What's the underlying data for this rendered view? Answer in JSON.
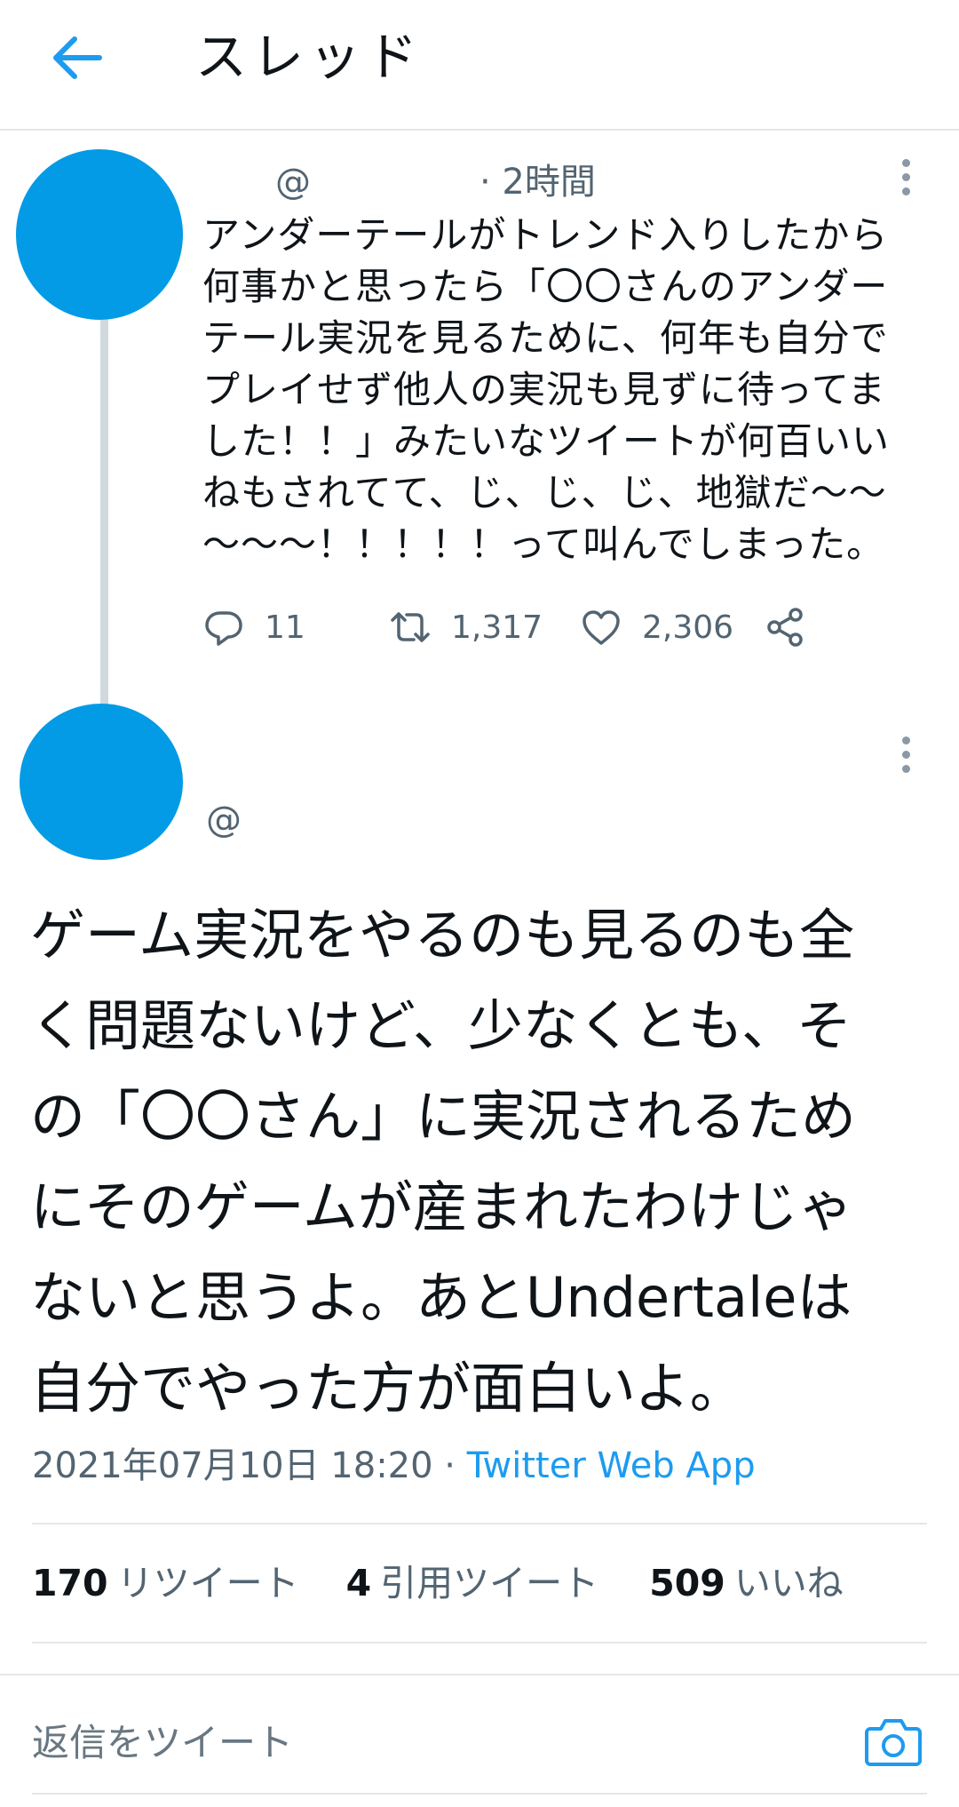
{
  "header": {
    "title": "スレッド",
    "back_icon": "arrow-left-icon",
    "accent": "#1d9bf0"
  },
  "avatar_color": "#039be5",
  "tweet1": {
    "handle": "@",
    "time": "· 2時間",
    "text": "アンダーテールがトレンド入りしたから\n何事かと思ったら「〇〇さんのアンダー\nテール実況を見るために、何年も自分で\nプレイせず他人の実況も見ずに待ってま\nした！！」みたいなツイートが何百いい\nねもされてて、じ、じ、じ、地獄だ〜〜\n〜〜〜！！！！！って叫んでしまった。",
    "replies": "11",
    "retweets": "1,317",
    "likes": "2,306"
  },
  "tweet2": {
    "handle": "@",
    "text": "ゲーム実況をやるのも見るのも全\nく問題ないけど、少なくとも、そ\nの「〇〇さん」に実況されるため\nにそのゲームが産まれたわけじゃ\nないと思うよ。あとUndertaleは\n自分でやった方が面白いよ。",
    "date": "2021年07月10日 18:20 · ",
    "source": "Twitter Web App",
    "retweet_count": "170",
    "retweet_label": "リツイート",
    "quote_count": "4",
    "quote_label": "引用ツイート",
    "like_count": "509",
    "like_label": "いいね"
  },
  "compose": {
    "placeholder": "返信をツイート",
    "camera_icon": "camera-icon"
  }
}
